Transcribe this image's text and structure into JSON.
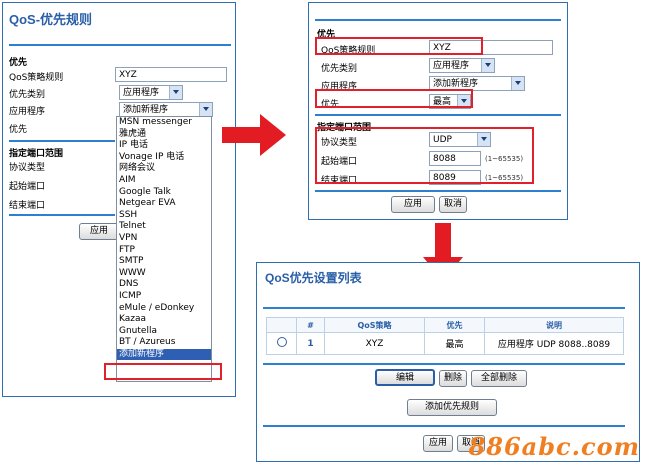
{
  "left_panel": {
    "title": "QoS-优先规则",
    "section_priority": "优先",
    "rule_label": "QoS策略规则",
    "rule_value": "XYZ",
    "category_label": "优先类别",
    "category_value": "应用程序",
    "application_label": "应用程序",
    "application_value": "添加新程序",
    "priority_label": "优先",
    "port_section": "指定端口范围",
    "protocol_label": "协议类型",
    "start_port_label": "起始端口",
    "end_port_label": "结束端口",
    "apply_button": "应用",
    "dropdown_options": [
      "MSN messenger",
      "雅虎通",
      "IP 电话",
      "Vonage IP 电话",
      "网络会议",
      "AIM",
      "Google Talk",
      "Netgear EVA",
      "SSH",
      "Telnet",
      "VPN",
      "FTP",
      "SMTP",
      "WWW",
      "DNS",
      "ICMP",
      "eMule / eDonkey",
      "Kazaa",
      "Gnutella",
      "BT / Azureus",
      "添加新程序"
    ],
    "dropdown_selected": "添加新程序"
  },
  "right_panel": {
    "section_priority": "优先",
    "rule_label": "QoS策略规则",
    "rule_value": "XYZ",
    "category_label": "优先类别",
    "category_value": "应用程序",
    "application_label": "应用程序",
    "application_value": "添加新程序",
    "priority_label": "优先",
    "priority_value": "最高",
    "port_section": "指定端口范围",
    "protocol_label": "协议类型",
    "protocol_value": "UDP",
    "start_port_label": "起始端口",
    "start_port_value": "8088",
    "start_port_hint": "(1~65535)",
    "end_port_label": "结束端口",
    "end_port_value": "8089",
    "end_port_hint": "(1~65535)",
    "apply_button": "应用",
    "cancel_button": "取消"
  },
  "bottom_panel": {
    "title": "QoS优先设置列表",
    "columns": [
      "#",
      "QoS策略",
      "优先",
      "说明"
    ],
    "rows": [
      {
        "index": "1",
        "policy": "XYZ",
        "priority": "最高",
        "description": "应用程序 UDP 8088..8089"
      }
    ],
    "edit_button": "编辑",
    "delete_button": "删除",
    "delete_all_button": "全部删除",
    "add_rule_button": "添加优先规则",
    "apply_button": "应用",
    "cancel_button": "取消"
  },
  "watermark": "886abc.com",
  "colors": {
    "accent_blue": "#2f7fd0",
    "title_blue": "#2a5fa8",
    "highlight_red": "#e0202a",
    "selection_blue": "#2f5fb3",
    "watermark_orange": "#f07f22"
  }
}
